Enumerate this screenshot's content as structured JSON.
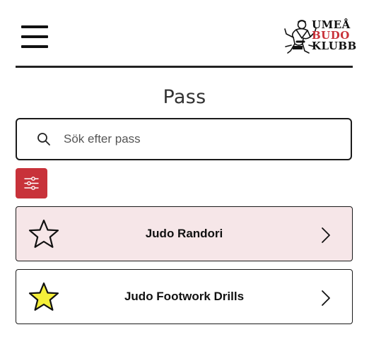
{
  "header": {
    "logo": {
      "line1": "UMEÅ",
      "line2": "BUDO",
      "line3": "KLUBB",
      "line2_color": "#c8323a"
    },
    "menu_icon": "hamburger-menu-icon"
  },
  "page": {
    "title": "Pass"
  },
  "search": {
    "placeholder": "Sök efter pass",
    "value": "",
    "icon": "search-icon"
  },
  "filter": {
    "icon": "sliders-icon",
    "color": "#c8323a"
  },
  "sessions": [
    {
      "label": "Judo Randori",
      "favorite": false,
      "highlighted": true,
      "highlight_color": "#f6e6e8"
    },
    {
      "label": "Judo Footwork Drills",
      "favorite": true,
      "highlighted": false,
      "star_color": "#f5ef3a"
    }
  ]
}
